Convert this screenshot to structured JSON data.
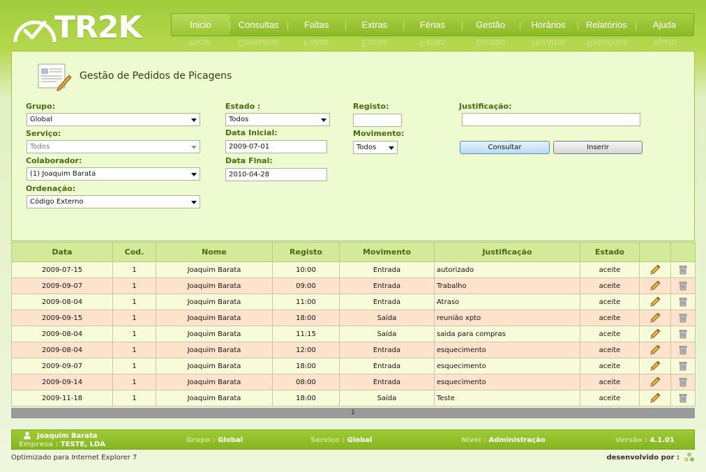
{
  "logo": {
    "text": "TR2K"
  },
  "nav": {
    "items": [
      "Inicio",
      "Consultas",
      "Faltas",
      "Extras",
      "Férias",
      "Gestão",
      "Horários",
      "Relatórios",
      "Ajuda"
    ],
    "active": "Inicio"
  },
  "panel": {
    "title": "Gestão de Pedidos de Picagens"
  },
  "form": {
    "grupo_label": "Grupo:",
    "grupo_value": "Global",
    "servico_label": "Serviço:",
    "servico_value": "Todos",
    "colaborador_label": "Colaborador:",
    "colaborador_value": "(1) Joaquim Barata",
    "ordenacao_label": "Ordenação:",
    "ordenacao_value": "Código Externo",
    "estado_label": "Estado :",
    "estado_value": "Todos",
    "data_inicial_label": "Data Inicial:",
    "data_inicial_value": "2009-07-01",
    "data_final_label": "Data Final:",
    "data_final_value": "2010-04-28",
    "registo_label": "Registo:",
    "registo_value": "",
    "movimento_label": "Movimento:",
    "movimento_value": "Todos",
    "justificacao_label": "Justificação:",
    "justificacao_value": "",
    "consultar_label": "Consultar",
    "inserir_label": "Inserir"
  },
  "table": {
    "headers": [
      "Data",
      "Cod.",
      "Nome",
      "Registo",
      "Movimento",
      "Justificação",
      "Estado",
      "",
      ""
    ],
    "rows": [
      [
        "2009-07-15",
        "1",
        "Joaquim Barata",
        "10:00",
        "Entrada",
        "autorizado",
        "aceite"
      ],
      [
        "2009-09-07",
        "1",
        "Joaquim Barata",
        "09:00",
        "Entrada",
        "Trabalho",
        "aceite"
      ],
      [
        "2009-08-04",
        "1",
        "Joaquim Barata",
        "11:00",
        "Entrada",
        "Atraso",
        "aceite"
      ],
      [
        "2009-09-15",
        "1",
        "Joaquim Barata",
        "18:00",
        "Saída",
        "reunião xpto",
        "aceite"
      ],
      [
        "2009-08-04",
        "1",
        "Joaquim Barata",
        "11:15",
        "Saída",
        "saida para compras",
        "aceite"
      ],
      [
        "2009-08-04",
        "1",
        "Joaquim Barata",
        "12:00",
        "Entrada",
        "esquecimento",
        "aceite"
      ],
      [
        "2009-09-07",
        "1",
        "Joaquim Barata",
        "18:00",
        "Entrada",
        "esquecimento",
        "aceite"
      ],
      [
        "2009-09-14",
        "1",
        "Joaquim Barata",
        "08:00",
        "Entrada",
        "esquecimento",
        "aceite"
      ],
      [
        "2009-11-18",
        "1",
        "Joaquim Barata",
        "18:00",
        "Saída",
        "Teste",
        "aceite"
      ]
    ],
    "row_icons": [
      "edit-pencil-icon",
      "delete-trash-icon"
    ],
    "page": "1"
  },
  "footer": {
    "user_name": "Joaquim Barata",
    "empresa_label": "Empresa :",
    "empresa_value": "TESTE, LDA",
    "grupo_label": "Grupo :",
    "grupo_value": "Global",
    "servico_label": "Serviço :",
    "servico_value": "Global",
    "nivel_label": "Nível :",
    "nivel_value": "Administração",
    "versao_label": "Versão :",
    "versao_value": "4.1.01"
  },
  "bottom": {
    "left_text": "Optimizado para Internet Explorer 7",
    "right_text": "desenvolvido por :"
  },
  "colors": {
    "accent_green": "#8cba28",
    "panel_bg": "#eefbd0",
    "row_odd": "#f8fbd9",
    "row_even": "#fde3cb"
  }
}
